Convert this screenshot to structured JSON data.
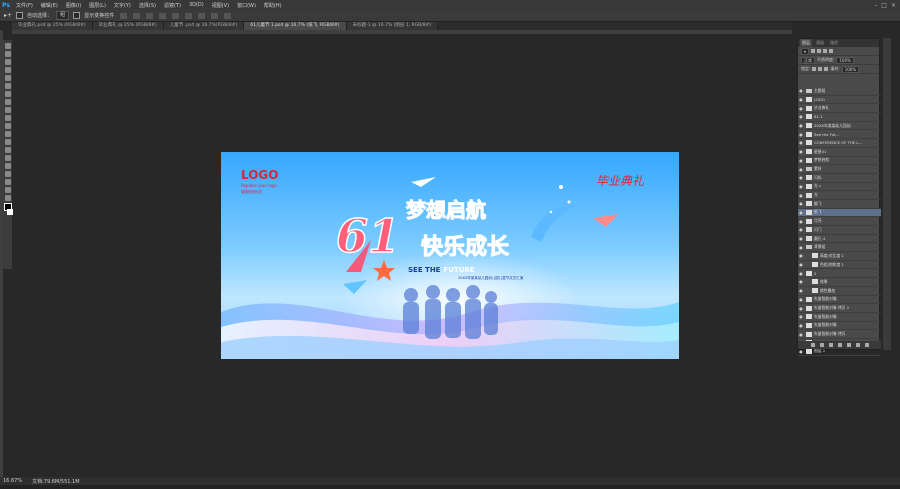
{
  "app": {
    "logo": "Ps"
  },
  "menu": [
    "文件(F)",
    "编辑(E)",
    "图像(I)",
    "图层(L)",
    "文字(Y)",
    "选择(S)",
    "滤镜(T)",
    "3D(D)",
    "视图(V)",
    "窗口(W)",
    "帮助(H)"
  ],
  "options": {
    "auto_select_label": "自动选择：",
    "auto_select_value": "组",
    "transform_label": "显示变换控件"
  },
  "tabs": [
    {
      "label": "毕业典礼.psd @ 25% (RGB/8#)",
      "active": false
    },
    {
      "label": "毕业典礼 @ 25% (RGB/8#)",
      "active": false
    },
    {
      "label": "儿童节 .psd @ 16.7%(RGB/8#)",
      "active": false
    },
    {
      "label": "61儿童节 1.psd @ 16.7% (纸飞, RGB/8#)",
      "active": true
    },
    {
      "label": "未标题-1 @ 16.7% (图层 1, RGB/8#)",
      "active": false
    }
  ],
  "status": {
    "zoom": "16.67%",
    "doc": "文档:79.6M/551.1M"
  },
  "banner": {
    "logo": "LOGO",
    "logo_sub": "Replace your logo",
    "logo_sub2": "替换您的标志",
    "top_right": "毕业典礼",
    "number": "61",
    "title1": "梦想启航",
    "title2": "快乐成长",
    "see": "SEE THE",
    "future": "FUTURE",
    "caption": "20XX年某某幼儿园幼儿园儿童节文艺汇演"
  },
  "panel": {
    "tabs": [
      "图层",
      "通道",
      "路径"
    ],
    "blend": "正常",
    "opacity_label": "不透明度:",
    "opacity": "100%",
    "lock_label": "锁定:",
    "fill_label": "填充:",
    "fill": "100%",
    "layers": [
      {
        "name": "主题组",
        "type": "folder"
      },
      {
        "name": "LOGO",
        "type": "layer"
      },
      {
        "name": "毕业典礼",
        "type": "layer"
      },
      {
        "name": "61-1",
        "type": "layer"
      },
      {
        "name": "20XX年某某幼儿园幼",
        "type": "text"
      },
      {
        "name": "See the Fut...",
        "type": "layer"
      },
      {
        "name": "CONFERENCE OF THE L...",
        "type": "text"
      },
      {
        "name": "星星01",
        "type": "layer"
      },
      {
        "name": "梦想启航",
        "type": "layer"
      },
      {
        "name": "素材",
        "type": "folder"
      },
      {
        "name": "闪烁",
        "type": "layer"
      },
      {
        "name": "光 c",
        "type": "layer"
      },
      {
        "name": "光",
        "type": "layer"
      },
      {
        "name": "翻飞",
        "type": "layer"
      },
      {
        "name": "纸飞",
        "type": "layer",
        "selected": true
      },
      {
        "name": "月亮",
        "type": "layer"
      },
      {
        "name": "闪门",
        "type": "layer"
      },
      {
        "name": "圆孔 4",
        "type": "layer"
      },
      {
        "name": "背景组",
        "type": "folder"
      },
      {
        "name": "高度/对比度 1",
        "type": "adj"
      },
      {
        "name": "色相/饱和度 1",
        "type": "adj"
      },
      {
        "name": "2",
        "type": "layer"
      },
      {
        "name": "效果",
        "type": "fx"
      },
      {
        "name": "颜色叠加",
        "type": "fx"
      },
      {
        "name": "矢量智能对象",
        "type": "layer"
      },
      {
        "name": "矢量智能对象 拷贝 2",
        "type": "layer"
      },
      {
        "name": "矢量智能对象",
        "type": "layer"
      },
      {
        "name": "矢量智能对象",
        "type": "layer"
      },
      {
        "name": "矢量智能对象 拷贝",
        "type": "layer"
      },
      {
        "name": "2",
        "type": "layer"
      },
      {
        "name": "图层 1",
        "type": "layer"
      }
    ]
  }
}
